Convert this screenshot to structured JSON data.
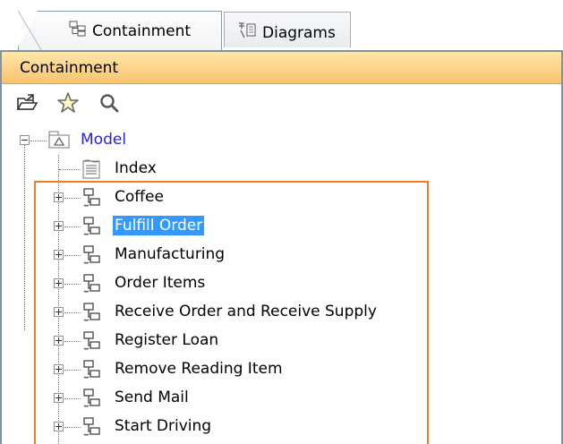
{
  "tabs": [
    {
      "label": "Containment",
      "icon": "containment-tree-icon",
      "active": true
    },
    {
      "label": "Diagrams",
      "icon": "diagrams-icon",
      "active": false
    }
  ],
  "panel": {
    "title": "Containment"
  },
  "toolbar": {
    "buttons": [
      "open-folder-icon",
      "star-icon",
      "search-icon"
    ]
  },
  "tree": {
    "root": {
      "label": "Model",
      "icon": "model-package-icon",
      "expanded": true
    },
    "items": [
      {
        "label": "Index",
        "icon": "document-icon",
        "expandable": false
      },
      {
        "label": "Coffee",
        "icon": "diagram-element-icon",
        "expandable": true
      },
      {
        "label": "Fulfill Order",
        "icon": "diagram-element-icon",
        "expandable": true,
        "selected": true
      },
      {
        "label": "Manufacturing",
        "icon": "diagram-element-icon",
        "expandable": true
      },
      {
        "label": "Order Items",
        "icon": "diagram-element-icon",
        "expandable": true
      },
      {
        "label": "Receive Order and Receive Supply",
        "icon": "diagram-element-icon",
        "expandable": true
      },
      {
        "label": "Register Loan",
        "icon": "diagram-element-icon",
        "expandable": true
      },
      {
        "label": "Remove Reading Item",
        "icon": "diagram-element-icon",
        "expandable": true
      },
      {
        "label": "Send Mail",
        "icon": "diagram-element-icon",
        "expandable": true
      },
      {
        "label": "Start Driving",
        "icon": "diagram-element-icon",
        "expandable": true
      }
    ]
  },
  "colors": {
    "highlight": "#ed7d31",
    "selection": "#3399ff",
    "header": "#f8c46e",
    "model_text": "#2324d8"
  }
}
